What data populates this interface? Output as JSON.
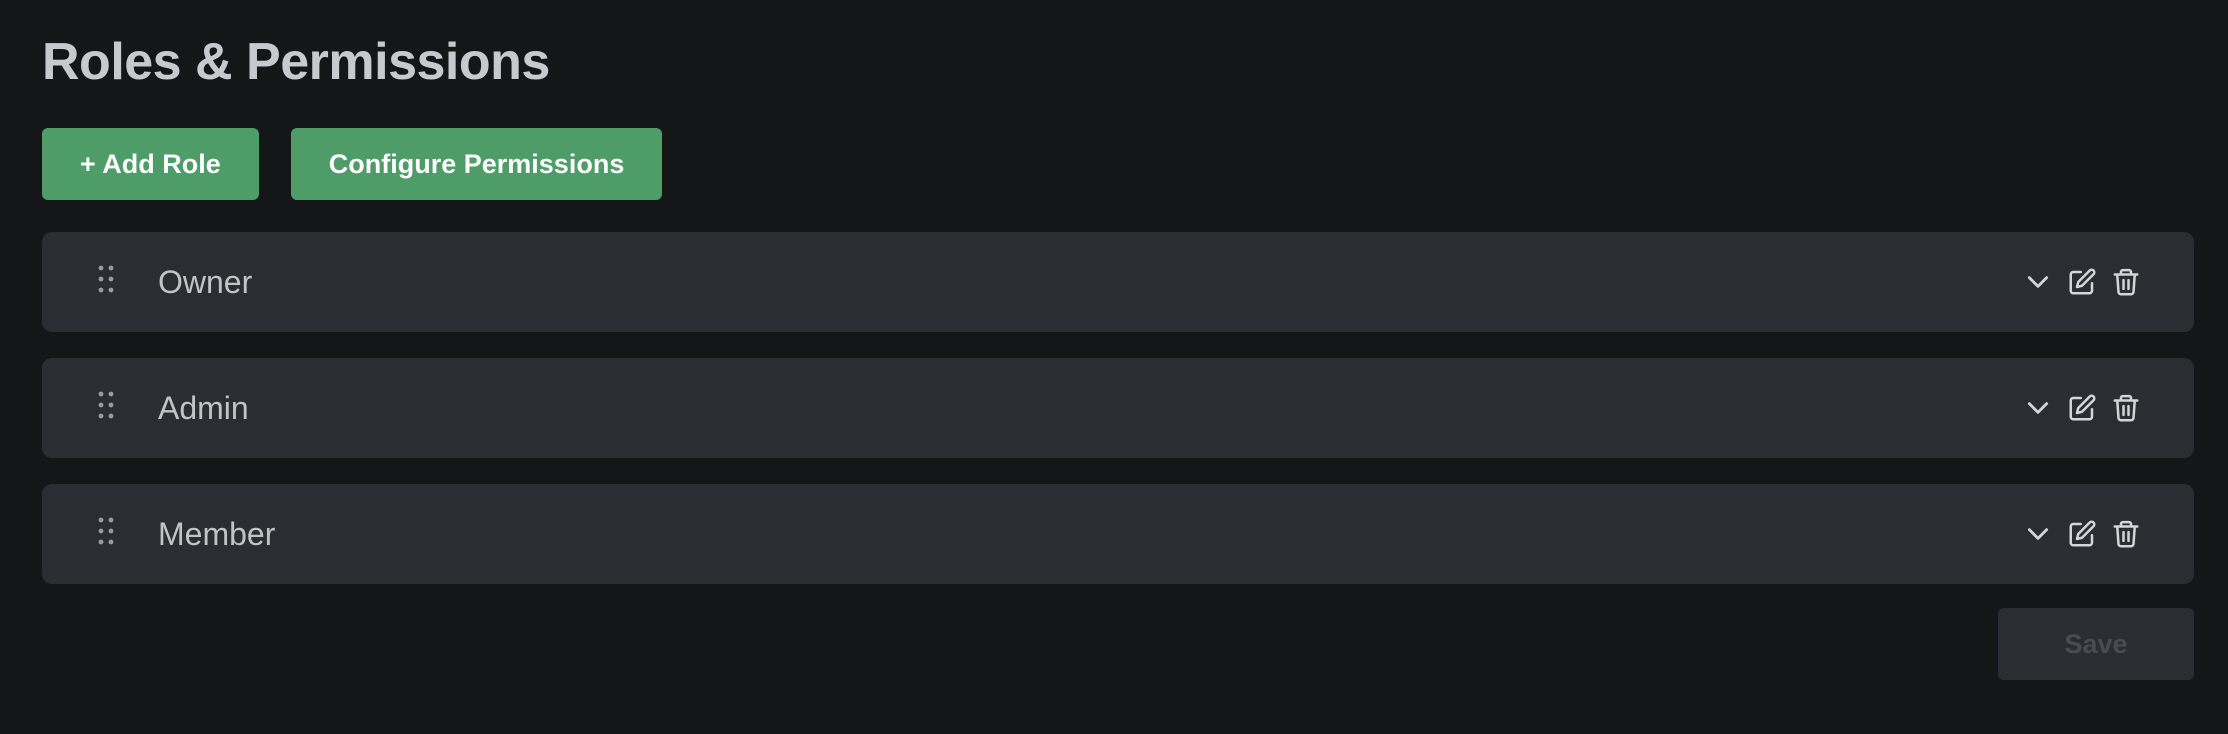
{
  "page": {
    "title": "Roles & Permissions"
  },
  "actions": {
    "add_role_label": "+ Add Role",
    "configure_permissions_label": "Configure Permissions"
  },
  "roles": [
    {
      "name": "Owner"
    },
    {
      "name": "Admin"
    },
    {
      "name": "Member"
    }
  ],
  "row_icons": [
    "drag-handle-icon",
    "chevron-down-icon",
    "edit-icon",
    "trash-icon"
  ],
  "footer": {
    "save_label": "Save",
    "save_disabled": true
  },
  "colors": {
    "background": "#151618",
    "row_background": "#2c2d32",
    "primary_button": "#4e9d69",
    "text": "#c7c8cc"
  }
}
